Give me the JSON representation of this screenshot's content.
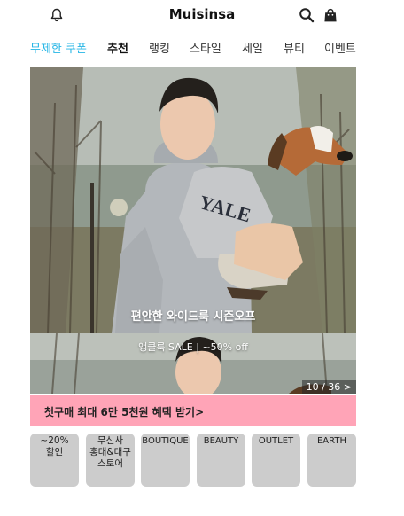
{
  "header": {
    "title": "Muisinsa",
    "icons": [
      "bell-icon",
      "search-icon",
      "shopping-bag-icon"
    ]
  },
  "nav": {
    "tabs": [
      {
        "label": "무제한 쿠폰",
        "state": "highlight"
      },
      {
        "label": "추천",
        "state": "active"
      },
      {
        "label": "랭킹",
        "state": "normal"
      },
      {
        "label": "스타일",
        "state": "normal"
      },
      {
        "label": "세일",
        "state": "normal"
      },
      {
        "label": "뷰티",
        "state": "normal"
      },
      {
        "label": "이벤트",
        "state": "normal"
      }
    ]
  },
  "banner": {
    "caption_title": "편안한 와이드룩 시즌오프",
    "caption_sub": "앵클룩 SALE | ~50% off",
    "counter": "10 / 36 >"
  },
  "promo": {
    "text": "첫구매 최대 6만 5천원 혜택 받기>"
  },
  "categories": [
    {
      "label": "~20%\n할인"
    },
    {
      "label": "무신사\n홍대&대구\n스토어"
    },
    {
      "label": "BOUTIQUE"
    },
    {
      "label": "BEAUTY"
    },
    {
      "label": "OUTLET"
    },
    {
      "label": "EARTH"
    }
  ],
  "colors": {
    "coupon_tab": "#26b6e6",
    "promo_bg": "#ffa4b7",
    "category_bg": "#cccccc"
  }
}
